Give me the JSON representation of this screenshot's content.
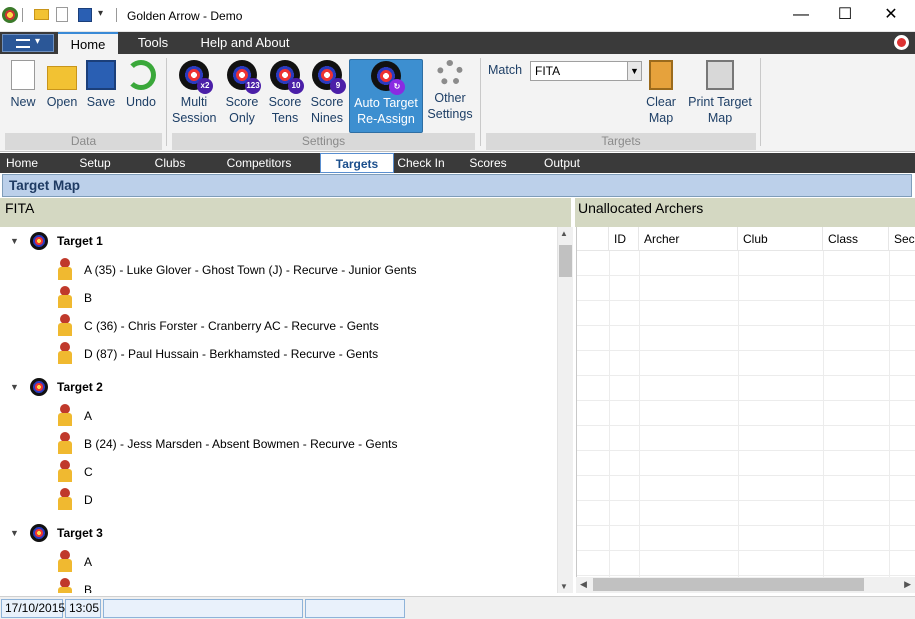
{
  "window": {
    "title": "Golden Arrow - Demo",
    "minimize": "—",
    "maximize": "☐",
    "close": "✕"
  },
  "menu": {
    "tabs": [
      "Home",
      "Tools",
      "Help and About"
    ],
    "active": "Home"
  },
  "ribbon": {
    "data_group": {
      "label": "Data",
      "buttons": [
        "New",
        "Open",
        "Save",
        "Undo"
      ]
    },
    "settings_group": {
      "label": "Settings",
      "multi": [
        "Multi",
        "Session"
      ],
      "score_only": [
        "Score",
        "Only"
      ],
      "score_tens": [
        "Score",
        "Tens"
      ],
      "score_nines": [
        "Score",
        "Nines"
      ],
      "auto": [
        "Auto Target",
        "Re-Assign"
      ],
      "other": [
        "Other",
        "Settings"
      ],
      "badges": {
        "multi": "x2",
        "only": "123",
        "tens": "10",
        "nines": "9"
      }
    },
    "targets_group": {
      "label": "Targets",
      "match_label": "Match",
      "match_value": "FITA",
      "clear": [
        "Clear",
        "Map"
      ],
      "print": [
        "Print Target",
        "Map"
      ]
    }
  },
  "nav": {
    "tabs": [
      "Home",
      "Setup",
      "Clubs",
      "Competitors",
      "Targets",
      "Check In",
      "Scores",
      "Output"
    ],
    "active": "Targets"
  },
  "target_map": {
    "heading": "Target Map",
    "round": "FITA",
    "targets": [
      {
        "name": "Target 1",
        "archers": [
          "A (35) - Luke Glover - Ghost Town (J) - Recurve - Junior Gents",
          "B",
          "C (36) - Chris Forster - Cranberry AC - Recurve - Gents",
          "D (87) - Paul Hussain - Berkhamsted - Recurve - Gents"
        ]
      },
      {
        "name": "Target 2",
        "archers": [
          "A",
          "B (24) - Jess Marsden - Absent Bowmen - Recurve - Gents",
          "C",
          "D"
        ]
      },
      {
        "name": "Target 3",
        "archers": [
          "A",
          "B"
        ]
      }
    ]
  },
  "unallocated": {
    "heading": "Unallocated Archers",
    "columns": [
      "ID",
      "Archer",
      "Club",
      "Class",
      "Sec"
    ]
  },
  "status": {
    "date": "17/10/2015",
    "time": "13:05"
  },
  "colors": {
    "accent": "#3d8fd0",
    "menu_bg": "#3a3a3a",
    "header_bg": "#bcd0ea"
  }
}
